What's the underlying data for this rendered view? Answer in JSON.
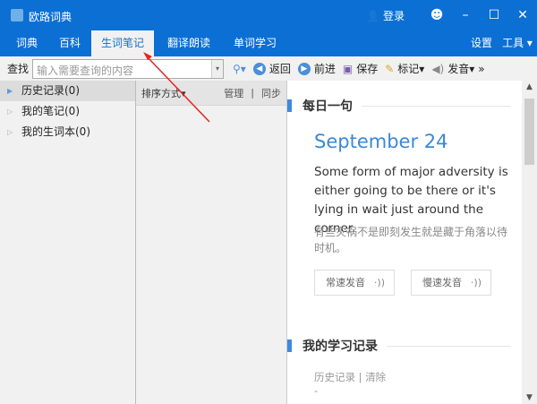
{
  "window": {
    "title": "欧路词典",
    "login": "登录",
    "smile": "☻",
    "minimize": "–",
    "maximize": "☐",
    "close": "✕"
  },
  "tabs": [
    {
      "label": "词典"
    },
    {
      "label": "百科"
    },
    {
      "label": "生词笔记"
    },
    {
      "label": "翻译朗读"
    },
    {
      "label": "单词学习"
    }
  ],
  "tabs_right": {
    "settings": "设置",
    "tools": "工具 ▾"
  },
  "toolbar": {
    "find_label": "查找",
    "search_placeholder": "输入需要查询的内容",
    "back": "返回",
    "forward": "前进",
    "save": "保存",
    "mark": "标记",
    "speak": "发音",
    "more": "»"
  },
  "left_tree": [
    {
      "label": "历史记录(0)"
    },
    {
      "label": "我的笔记(0)"
    },
    {
      "label": "我的生词本(0)"
    }
  ],
  "middle": {
    "sort": "排序方式▾",
    "manage": "管理",
    "sep": "|",
    "sync": "同步"
  },
  "daily": {
    "heading": "每日一句",
    "date": "September 24",
    "english": "Some form of major adversity is either going to be there or it's lying in wait just around the corner.",
    "chinese": "有些灾祸不是即刻发生就是藏于角落以待时机。",
    "normal_speed": "常速发音",
    "slow_speed": "慢速发音"
  },
  "study": {
    "heading": "我的学习记录",
    "history": "历史记录",
    "sep": "|",
    "clear": "清除",
    "dash": "-"
  }
}
